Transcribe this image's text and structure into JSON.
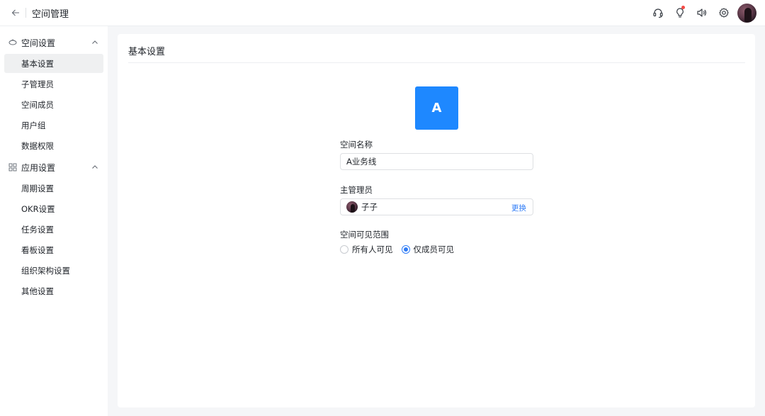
{
  "header": {
    "title": "空间管理",
    "icons": [
      "back-arrow-icon",
      "headset-icon",
      "lightbulb-icon",
      "speaker-icon",
      "gear-icon"
    ],
    "has_notification_dot": true
  },
  "sidebar": {
    "groups": [
      {
        "label": "空间设置",
        "icon": "layers-icon",
        "items": [
          {
            "label": "基本设置",
            "active": true
          },
          {
            "label": "子管理员"
          },
          {
            "label": "空间成员"
          },
          {
            "label": "用户组"
          },
          {
            "label": "数据权限"
          }
        ]
      },
      {
        "label": "应用设置",
        "icon": "grid-icon",
        "items": [
          {
            "label": "周期设置"
          },
          {
            "label": "OKR设置"
          },
          {
            "label": "任务设置"
          },
          {
            "label": "看板设置"
          },
          {
            "label": "组织架构设置"
          },
          {
            "label": "其他设置"
          }
        ]
      }
    ]
  },
  "main": {
    "title": "基本设置",
    "space_avatar_letter": "A",
    "name_label": "空间名称",
    "name_value": "A业务线",
    "owner_label": "主管理员",
    "owner_name": "子子",
    "change_label": "更换",
    "visibility_label": "空间可见范围",
    "visibility_options": [
      {
        "label": "所有人可见",
        "selected": false
      },
      {
        "label": "仅成员可见",
        "selected": true
      }
    ]
  },
  "colors": {
    "accent": "#1e88ff",
    "link": "#2f7cf6",
    "notification": "#f54a45"
  }
}
